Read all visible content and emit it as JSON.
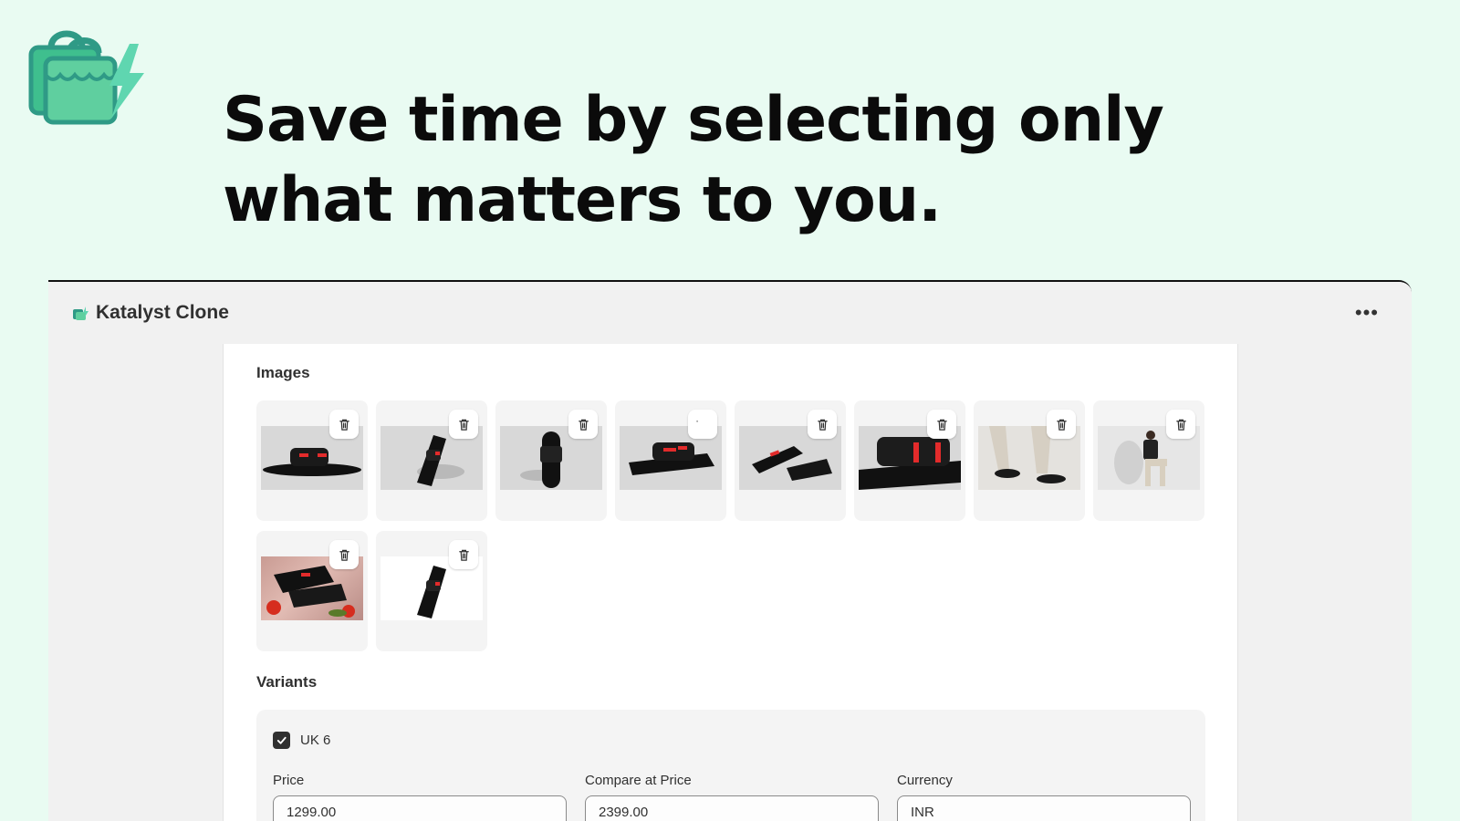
{
  "hero": {
    "headline_line1": "Save time by selecting only",
    "headline_line2": "what matters to you."
  },
  "colors": {
    "background": "#e9fbf2",
    "brand_green": "#3fbf8e",
    "brand_teal": "#2f9a86",
    "text_dark": "#303030"
  },
  "app": {
    "title": "Katalyst Clone",
    "menu_icon": "ellipsis-icon",
    "menu_glyph": "•••"
  },
  "images": {
    "section_title": "Images",
    "items": [
      {
        "alt": "sandal side view",
        "icon": "trash-icon"
      },
      {
        "alt": "sandal angled top",
        "icon": "trash-icon"
      },
      {
        "alt": "sandal top view",
        "icon": "trash-icon"
      },
      {
        "alt": "sandal front angle",
        "icon": "trash-icon"
      },
      {
        "alt": "sandals pair",
        "icon": "trash-icon"
      },
      {
        "alt": "sandal close-up",
        "icon": "trash-icon"
      },
      {
        "alt": "model wearing sandals",
        "icon": "trash-icon"
      },
      {
        "alt": "model seated",
        "icon": "trash-icon"
      },
      {
        "alt": "sandals lifestyle with tomatoes",
        "icon": "trash-icon"
      },
      {
        "alt": "sandal on white",
        "icon": "trash-icon"
      }
    ]
  },
  "variants": {
    "section_title": "Variants",
    "items": [
      {
        "name": "UK 6",
        "checked": true,
        "price_label": "Price",
        "price_value": "1299.00",
        "compare_label": "Compare at Price",
        "compare_value": "2399.00",
        "currency_label": "Currency",
        "currency_value": "INR"
      }
    ]
  }
}
